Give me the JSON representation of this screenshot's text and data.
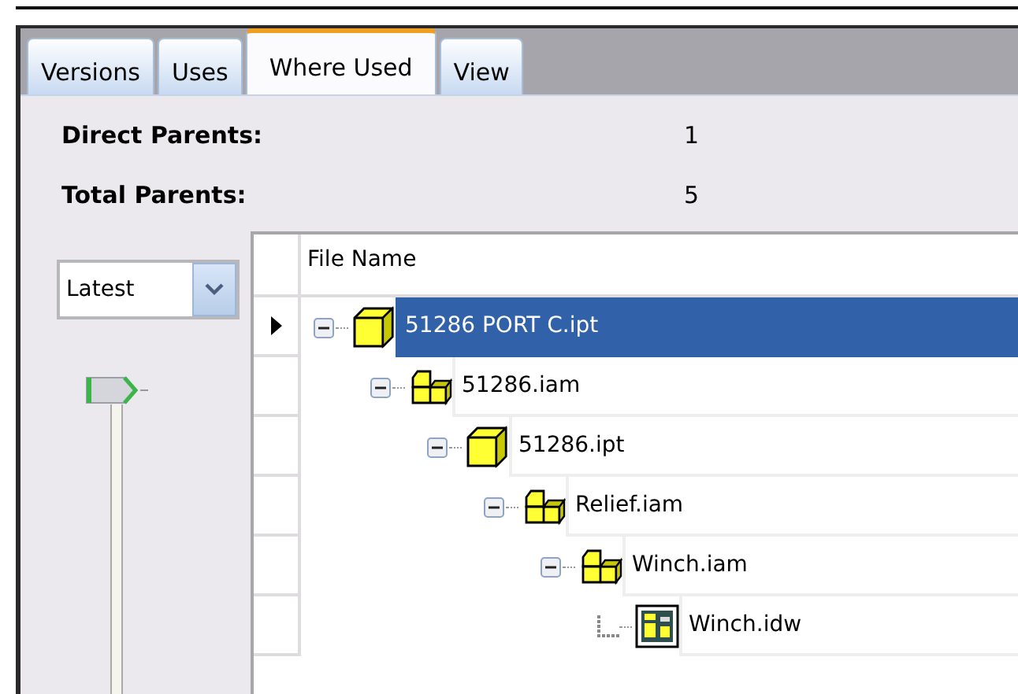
{
  "tabs": [
    {
      "label": "Versions",
      "selected": false
    },
    {
      "label": "Uses",
      "selected": false
    },
    {
      "label": "Where Used",
      "selected": true
    },
    {
      "label": "View",
      "selected": false
    }
  ],
  "summary": [
    {
      "label": "Direct Parents:",
      "value": "1"
    },
    {
      "label": "Total Parents:",
      "value": "5"
    }
  ],
  "version_select": {
    "value": "Latest"
  },
  "tree": {
    "columns": [
      "File Name"
    ],
    "rows": [
      {
        "name": "51286 PORT C.ipt",
        "kind": "part",
        "selected": true,
        "expanded": true,
        "children": [
          {
            "name": "51286.iam",
            "kind": "assembly",
            "selected": false,
            "expanded": true,
            "children": [
              {
                "name": "51286.ipt",
                "kind": "part",
                "selected": false,
                "expanded": true,
                "children": [
                  {
                    "name": "Relief.iam",
                    "kind": "assembly",
                    "selected": false,
                    "expanded": true,
                    "children": [
                      {
                        "name": "Winch.iam",
                        "kind": "assembly",
                        "selected": false,
                        "expanded": true,
                        "children": [
                          {
                            "name": "Winch.idw",
                            "kind": "drawing",
                            "selected": false
                          }
                        ]
                      }
                    ]
                  }
                ]
              }
            ]
          }
        ]
      }
    ]
  }
}
